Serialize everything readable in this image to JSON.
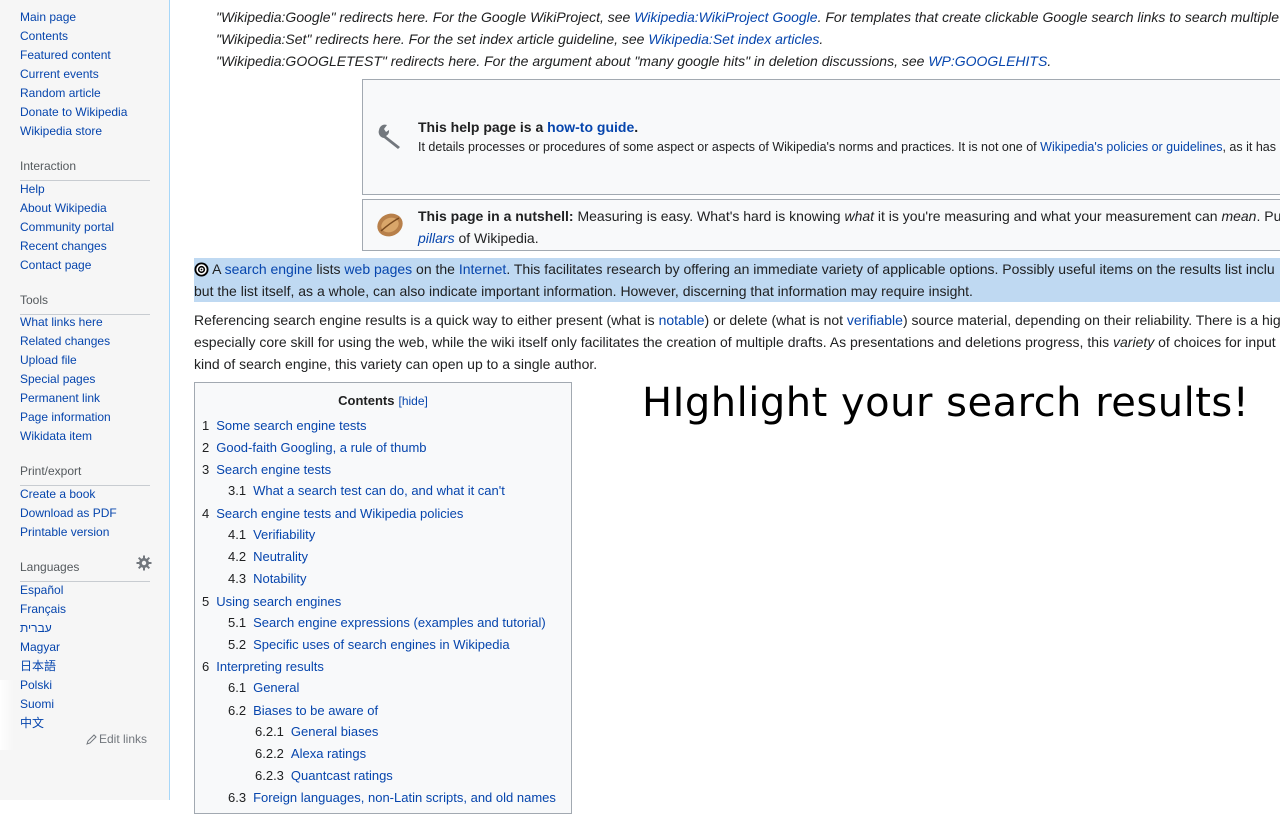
{
  "sidebar": {
    "navigation": [
      "Main page",
      "Contents",
      "Featured content",
      "Current events",
      "Random article",
      "Donate to Wikipedia",
      "Wikipedia store"
    ],
    "interaction_heading": "Interaction",
    "interaction": [
      "Help",
      "About Wikipedia",
      "Community portal",
      "Recent changes",
      "Contact page"
    ],
    "tools_heading": "Tools",
    "tools": [
      "What links here",
      "Related changes",
      "Upload file",
      "Special pages",
      "Permanent link",
      "Page information",
      "Wikidata item"
    ],
    "print_heading": "Print/export",
    "print": [
      "Create a book",
      "Download as PDF",
      "Printable version"
    ],
    "languages_heading": "Languages",
    "languages": [
      "Español",
      "Français",
      "עברית",
      "Magyar",
      "日本語",
      "Polski",
      "Suomi",
      "中文"
    ],
    "edit_links": "Edit links",
    "gear_icon": "gear-icon"
  },
  "hatnotes": {
    "h1_pre": "\"Wikipedia:Google\" redirects here. For the Google WikiProject, see ",
    "h1_link": "Wikipedia:WikiProject Google",
    "h1_post": ". For templates that create clickable Google search links to search multiple",
    "h2_pre": "\"Wikipedia:Set\" redirects here. For the set index article guideline, see ",
    "h2_link": "Wikipedia:Set index articles",
    "h2_post": ".",
    "h3_pre": "\"Wikipedia:GOOGLETEST\" redirects here. For the argument about \"many google hits\" in deletion discussions, see ",
    "h3_link": "WP:GOOGLEHITS",
    "h3_post": "."
  },
  "howto_box": {
    "title_pre": "This help page is a ",
    "title_link": "how-to guide",
    "title_post": ".",
    "text_pre": "It details processes or procedures of some aspect or aspects of Wikipedia's norms and practices. It is not one of ",
    "text_link": "Wikipedia's policies or guidelines",
    "text_post": ", as it has"
  },
  "nutshell_box": {
    "bold": "This page in a nutshell:",
    "t1": " Measuring is easy. What's hard is knowing ",
    "t1_em": "what",
    "t2": " it is you're measuring and what your measurement can ",
    "t2_em": "mean",
    "t3": ". Pu",
    "line2_link": "pillars",
    "line2_post": " of Wikipedia."
  },
  "intro": {
    "a": " A ",
    "l1": "search engine",
    "b": " lists ",
    "l2": "web pages",
    "c": " on the ",
    "l3": "Internet",
    "d": ". This facilitates research by offering an immediate variety of applicable options. Possibly useful items on the results list inclu",
    "line2": "but the list itself, as a whole, can also indicate important information. However, discerning that information may require insight."
  },
  "ref_para": {
    "a": "Referencing search engine results is a quick way to either present (what is ",
    "l1": "notable",
    "b": ") or delete (what is not ",
    "l2": "verifiable",
    "c": ") source material, depending on their reliability. There is a hig",
    "line2_a": "especially core skill for using the web, while the wiki itself only facilitates the creation of multiple drafts. As presentations and deletions progress, this ",
    "line2_em": "variety",
    "line2_b": " of choices for input",
    "line3": "kind of search engine, this variety can open up to a single author."
  },
  "toc": {
    "title": "Contents",
    "hide": "[hide]",
    "items": [
      {
        "num": "1",
        "label": "Some search engine tests"
      },
      {
        "num": "2",
        "label": "Good-faith Googling, a rule of thumb"
      },
      {
        "num": "3",
        "label": "Search engine tests"
      },
      {
        "num": "3.1",
        "label": "What a search test can do, and what it can't"
      },
      {
        "num": "4",
        "label": "Search engine tests and Wikipedia policies"
      },
      {
        "num": "4.1",
        "label": "Verifiability"
      },
      {
        "num": "4.2",
        "label": "Neutrality"
      },
      {
        "num": "4.3",
        "label": "Notability"
      },
      {
        "num": "5",
        "label": "Using search engines"
      },
      {
        "num": "5.1",
        "label": "Search engine expressions (examples and tutorial)"
      },
      {
        "num": "5.2",
        "label": "Specific uses of search engines in Wikipedia"
      },
      {
        "num": "6",
        "label": "Interpreting results"
      },
      {
        "num": "6.1",
        "label": "General"
      },
      {
        "num": "6.2",
        "label": "Biases to be aware of"
      },
      {
        "num": "6.2.1",
        "label": "General biases"
      },
      {
        "num": "6.2.2",
        "label": "Alexa ratings"
      },
      {
        "num": "6.2.3",
        "label": "Quantcast ratings"
      },
      {
        "num": "6.3",
        "label": "Foreign languages, non-Latin scripts, and old names"
      }
    ]
  },
  "banner": "HIghlight your search results!"
}
